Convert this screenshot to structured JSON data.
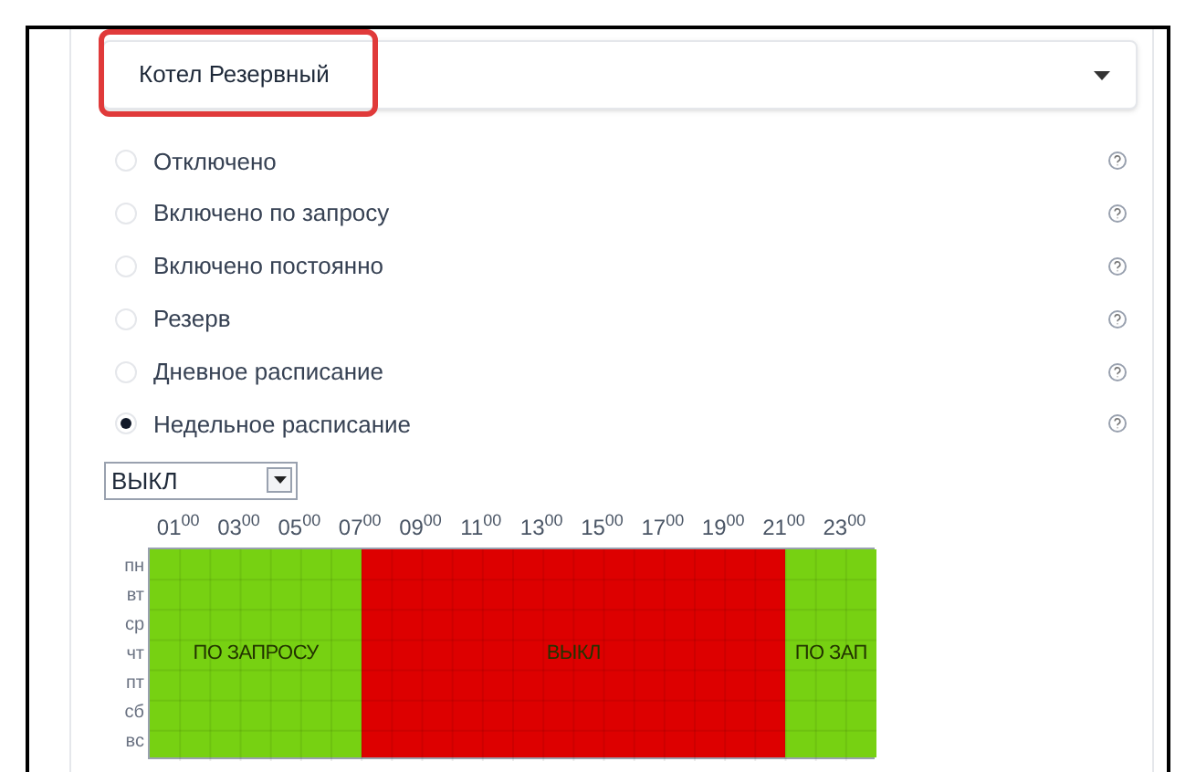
{
  "device_select": {
    "value": "Котел Резервный",
    "highlighted": true
  },
  "modes": [
    {
      "label": "Отключено",
      "selected": false
    },
    {
      "label": "Включено по запросу",
      "selected": false
    },
    {
      "label": "Включено постоянно",
      "selected": false
    },
    {
      "label": "Резерв",
      "selected": false
    },
    {
      "label": "Дневное расписание",
      "selected": false
    },
    {
      "label": "Недельное расписание",
      "selected": true
    }
  ],
  "schedule": {
    "brush_select": {
      "value": "ВЫКЛ"
    },
    "hours": [
      "01$^{00}$",
      "03$^{00}$",
      "05$^{00}$",
      "07$^{00}$",
      "09$^{00}$",
      "11$^{00}$",
      "13$^{00}$",
      "15$^{00}$",
      "17$^{00}$",
      "19$^{00}$",
      "21$^{00}$",
      "23$^{00}$"
    ],
    "days": [
      "пн",
      "вт",
      "ср",
      "чт",
      "пт",
      "сб",
      "вс"
    ],
    "hour_slots": [
      {
        "kind": "on_demand"
      },
      {
        "kind": "on_demand"
      },
      {
        "kind": "on_demand"
      },
      {
        "kind": "on_demand"
      },
      {
        "kind": "on_demand"
      },
      {
        "kind": "on_demand"
      },
      {
        "kind": "on_demand"
      },
      {
        "kind": "off"
      },
      {
        "kind": "off"
      },
      {
        "kind": "off"
      },
      {
        "kind": "off"
      },
      {
        "kind": "off"
      },
      {
        "kind": "off"
      },
      {
        "kind": "off"
      },
      {
        "kind": "off"
      },
      {
        "kind": "off"
      },
      {
        "kind": "off"
      },
      {
        "kind": "off"
      },
      {
        "kind": "off"
      },
      {
        "kind": "off"
      },
      {
        "kind": "off"
      },
      {
        "kind": "on_demand"
      },
      {
        "kind": "on_demand"
      },
      {
        "kind": "on_demand"
      }
    ],
    "block_labels": [
      "ПО ЗАПРОСУ",
      "ВЫКЛ",
      "ПО ЗАП"
    ]
  }
}
